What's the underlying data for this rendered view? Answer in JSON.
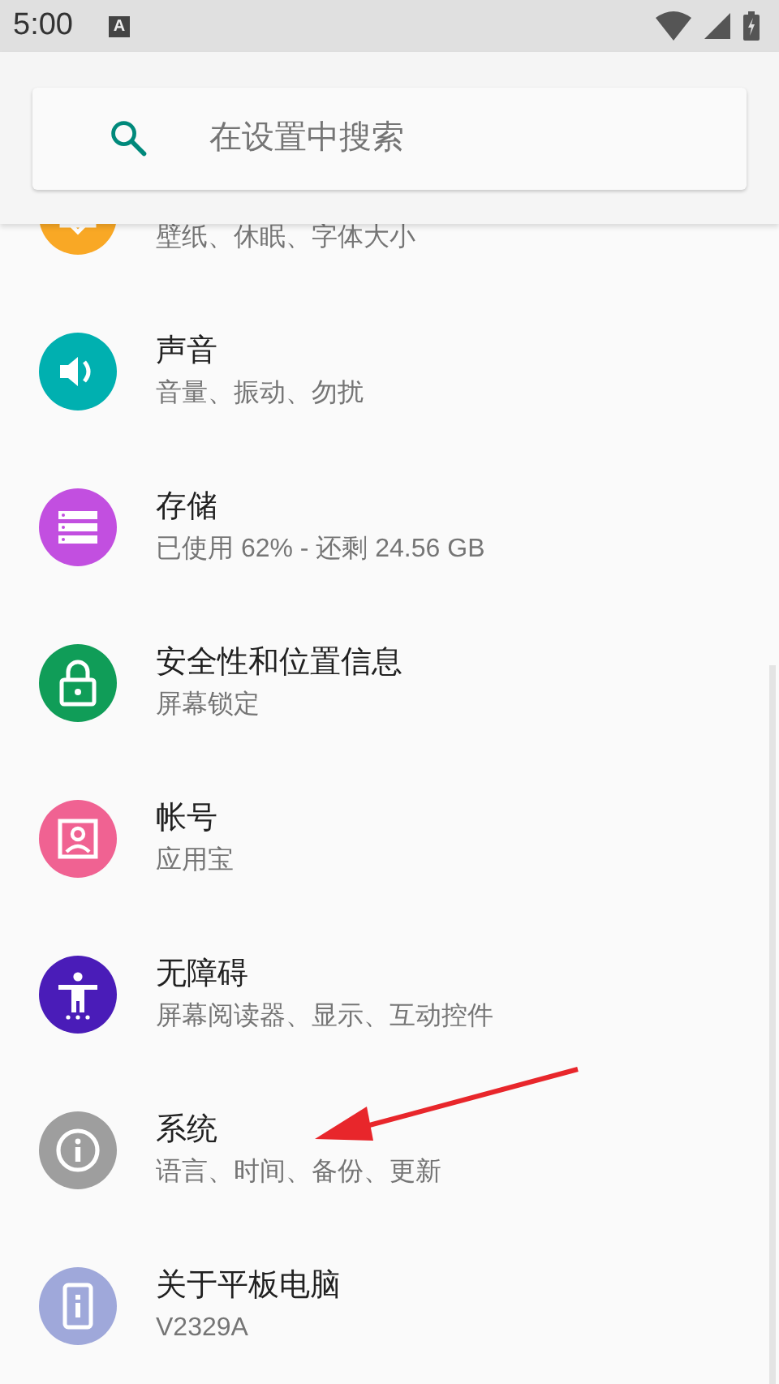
{
  "status_bar": {
    "time": "5:00",
    "notification_badge": "A"
  },
  "search": {
    "placeholder": "在设置中搜索"
  },
  "items": [
    {
      "kind": "display",
      "color": "#f9a825",
      "subtitle": "壁纸、休眠、字体大小"
    },
    {
      "kind": "sound",
      "color": "#00b0b0",
      "title": "声音",
      "subtitle": "音量、振动、勿扰"
    },
    {
      "kind": "storage",
      "color": "#c24fe0",
      "title": "存储",
      "subtitle": "已使用 62% - 还剩 24.56 GB"
    },
    {
      "kind": "lock",
      "color": "#109d58",
      "title": "安全性和位置信息",
      "subtitle": "屏幕锁定"
    },
    {
      "kind": "account",
      "color": "#f06292",
      "title": "帐号",
      "subtitle": "应用宝"
    },
    {
      "kind": "accessibility",
      "color": "#4a1cb8",
      "title": "无障碍",
      "subtitle": "屏幕阅读器、显示、互动控件"
    },
    {
      "kind": "info",
      "color": "#9e9e9e",
      "title": "系统",
      "subtitle": "语言、时间、备份、更新"
    },
    {
      "kind": "device",
      "color": "#9fa8da",
      "title": "关于平板电脑",
      "subtitle": "V2329A"
    }
  ]
}
